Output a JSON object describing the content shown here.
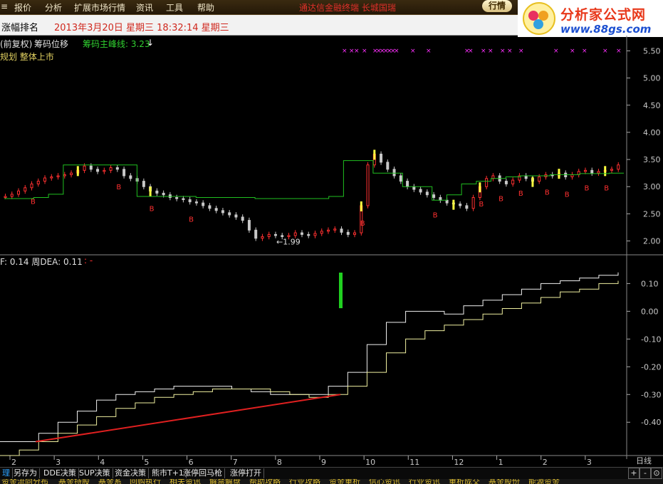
{
  "menu": {
    "items": [
      "报价",
      "分析",
      "扩展市场行情",
      "资讯",
      "工具",
      "帮助"
    ],
    "notice": "通达信金融终端 长城国瑞",
    "hq_button": "行情"
  },
  "logo": {
    "title": "分析家公式网",
    "url": "www.88gs.com"
  },
  "window": {
    "name": "涨幅排名",
    "datetime": "2013年3月20日  星期三  18:32:14  星期三"
  },
  "chart_info": {
    "mode": "(前复权)",
    "indicator": "筹码位移",
    "peak_label": "筹码主峰线: 3.23",
    "subtitle": "规划 整体上市",
    "low_label": "←1.99",
    "macd_label": "F: 0.14  周DEA: 0.11",
    "macd_extra": ": -"
  },
  "price_axis": [
    "5.50",
    "5.00",
    "4.50",
    "4.00",
    "3.50",
    "3.00",
    "2.50",
    "2.00"
  ],
  "indicator_axis": [
    "0.10",
    "0.00",
    "-0.10",
    "-0.20",
    "-0.30",
    "-0.40"
  ],
  "time_axis": [
    "2",
    "3",
    "4",
    "5",
    "6",
    "7",
    "8",
    "9",
    "10",
    "11",
    "12",
    "1",
    "2",
    "3"
  ],
  "period": "日线",
  "toolbar": [
    "理",
    "另存为",
    "DDE决策",
    "SUP决策",
    "资金决策",
    "熊市T+1",
    "涨停回马枪",
    "涨停打开"
  ],
  "controls": [
    "+",
    "-",
    "⊙"
  ],
  "bottom_tabs": [
    "资金流向分布",
    "基金持股",
    "基金系",
    "回购执行",
    "相关资讯",
    "解禁解盘",
    "帮助攻略",
    "行业攻略",
    "资金重析",
    "信心资讯",
    "行业资讯",
    "重析成交",
    "基金股份",
    "能源资金"
  ],
  "colors": {
    "up": "#ff3030",
    "down": "#c8c8c8",
    "peak_line": "#20c020",
    "signal": "#ffff40",
    "magenta": "#ff30ff",
    "trend": "#e02020"
  },
  "chart_data": {
    "type": "candlestick",
    "price_range": [
      1.85,
      5.65
    ],
    "indicator_range": [
      -0.52,
      0.16
    ],
    "x_labels": [
      "2",
      "3",
      "4",
      "5",
      "6",
      "7",
      "8",
      "9",
      "10",
      "11",
      "12",
      "1",
      "2",
      "3"
    ],
    "price_series": [
      2.82,
      2.86,
      2.92,
      2.98,
      3.05,
      3.1,
      3.16,
      3.18,
      3.2,
      3.22,
      3.25,
      3.3,
      3.38,
      3.32,
      3.28,
      3.3,
      3.35,
      3.32,
      3.2,
      3.15,
      3.1,
      3.0,
      2.92,
      2.88,
      2.85,
      2.8,
      2.78,
      2.76,
      2.72,
      2.7,
      2.65,
      2.6,
      2.56,
      2.52,
      2.48,
      2.44,
      2.38,
      2.2,
      2.05,
      2.08,
      2.12,
      2.1,
      2.08,
      2.1,
      2.15,
      2.12,
      2.1,
      2.14,
      2.18,
      2.2,
      2.22,
      2.16,
      2.12,
      2.15,
      2.65,
      3.4,
      3.6,
      3.45,
      3.32,
      3.2,
      3.1,
      3.0,
      2.95,
      2.9,
      2.85,
      2.8,
      2.75,
      2.7,
      2.68,
      2.65,
      2.6,
      2.8,
      3.0,
      3.15,
      3.2,
      3.1,
      3.05,
      3.12,
      3.2,
      3.15,
      3.1,
      3.18,
      3.22,
      3.2,
      3.25,
      3.18,
      3.22,
      3.28,
      3.3,
      3.25,
      3.28,
      3.3,
      3.32,
      3.4
    ],
    "peak_line": [
      2.78,
      2.78,
      2.8,
      2.86,
      3.4,
      3.4,
      3.4,
      3.4,
      3.4,
      2.82,
      2.82,
      2.82,
      2.82,
      2.8,
      2.8,
      2.8,
      2.8,
      2.78,
      2.78,
      2.78,
      2.78,
      2.78,
      2.82,
      3.48,
      3.48,
      3.25,
      3.25,
      3.0,
      3.0,
      2.75,
      2.85,
      3.05,
      3.1,
      3.15,
      3.18,
      3.2,
      3.2,
      3.22,
      3.22,
      3.24,
      3.24,
      3.25
    ],
    "indicator_line1": [
      -0.47,
      -0.47,
      -0.44,
      -0.4,
      -0.36,
      -0.32,
      -0.3,
      -0.29,
      -0.28,
      -0.27,
      -0.27,
      -0.27,
      -0.28,
      -0.29,
      -0.3,
      -0.3,
      -0.3,
      -0.27,
      -0.22,
      -0.12,
      -0.04,
      0.0,
      0.0,
      -0.01,
      0.02,
      0.04,
      0.06,
      0.08,
      0.1,
      0.11,
      0.12,
      0.13,
      0.14
    ],
    "indicator_line2": [
      -0.52,
      -0.5,
      -0.47,
      -0.44,
      -0.41,
      -0.38,
      -0.35,
      -0.33,
      -0.31,
      -0.3,
      -0.29,
      -0.28,
      -0.28,
      -0.28,
      -0.29,
      -0.3,
      -0.31,
      -0.3,
      -0.27,
      -0.22,
      -0.15,
      -0.1,
      -0.07,
      -0.05,
      -0.03,
      -0.01,
      0.01,
      0.03,
      0.05,
      0.07,
      0.08,
      0.1,
      0.11
    ],
    "trend_line": {
      "from": -0.47,
      "to": -0.3
    }
  }
}
